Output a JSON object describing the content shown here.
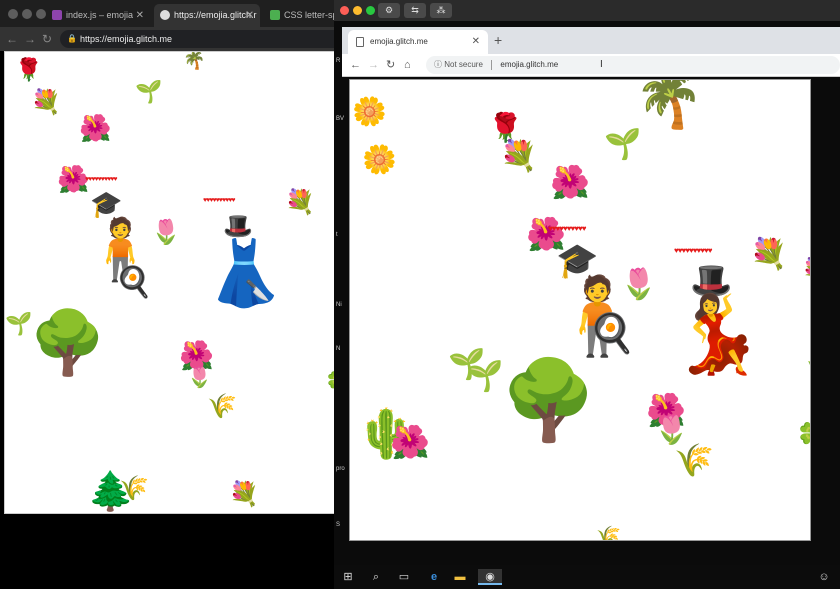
{
  "left_browser": {
    "tabs": [
      {
        "label": "index.js – emojia",
        "close": "✕"
      },
      {
        "label": "https://emojia.glitch.r",
        "close": "✕"
      },
      {
        "label": "CSS letter-spaci"
      }
    ],
    "url": "https://emojia.glitch.me"
  },
  "right_browser": {
    "tab_label": "emojia.glitch.me",
    "tab_close": "✕",
    "new_tab": "+",
    "security": "Not secure",
    "url": "emojia.glitch.me"
  },
  "left_game": {
    "hearts_1": "♥♥♥♥♥♥♥♥♥♥",
    "hearts_2": "♥♥♥♥♥♥♥♥♥♥"
  },
  "right_game": {
    "hearts_1": "♥♥♥♥♥♥♥♥♥♥",
    "hearts_2": "♥♥♥♥♥♥♥♥♥♥"
  },
  "side_strip": [
    "R",
    "BV",
    "t",
    "Ni",
    "N",
    "pro",
    "S"
  ],
  "colors": {
    "accent_red": "#e51a1a",
    "taskbar_active": "#76b9ed"
  },
  "icons": {
    "win_start": "windows-start-icon",
    "search": "search-icon",
    "task_view": "task-view-icon",
    "edge": "edge-icon",
    "explorer": "file-explorer-icon",
    "chrome": "chrome-icon"
  }
}
